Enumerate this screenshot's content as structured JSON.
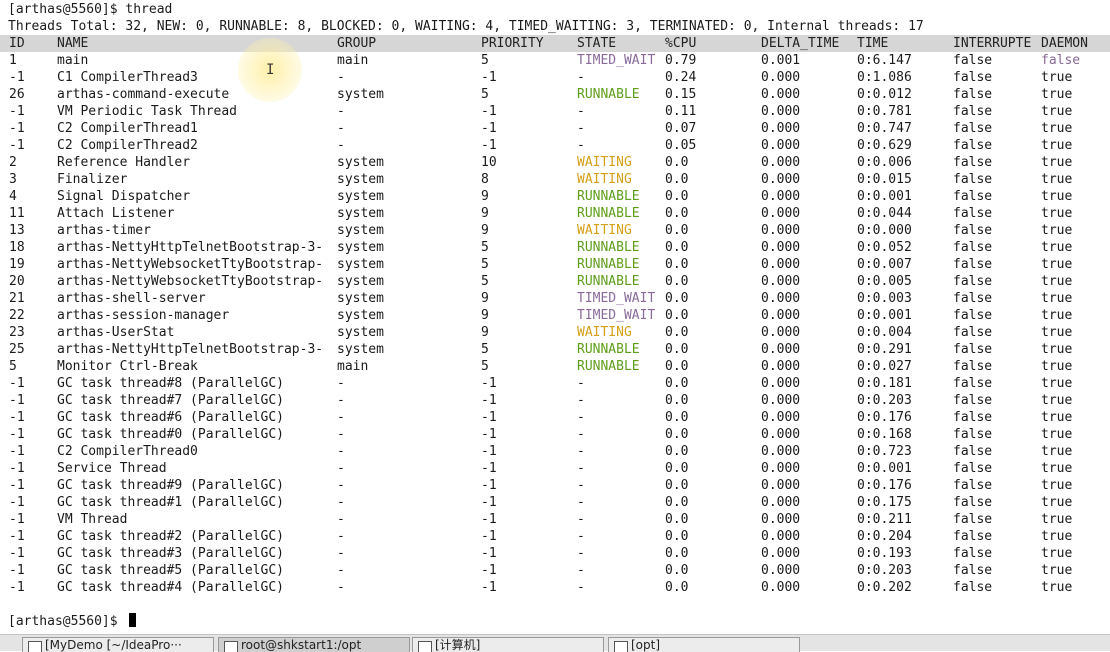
{
  "prompt": "[arthas@5560]$ ",
  "command": "thread",
  "summary": "Threads Total: 32, NEW: 0, RUNNABLE: 8, BLOCKED: 0, WAITING: 4, TIMED_WAITING: 3, TERMINATED: 0, Internal threads: 17",
  "columns": [
    "ID",
    "NAME",
    "GROUP",
    "PRIORITY",
    "STATE",
    "%CPU",
    "DELTA_TIME",
    "TIME",
    "INTERRUPTE",
    "DAEMON"
  ],
  "rows": [
    [
      "1",
      "main",
      "main",
      "5",
      "TIMED_WAIT",
      "0.79",
      "0.001",
      "0:6.147",
      "false",
      "false"
    ],
    [
      "-1",
      "C1 CompilerThread3",
      "-",
      "-1",
      "-",
      "0.24",
      "0.000",
      "0:1.086",
      "false",
      "true"
    ],
    [
      "26",
      "arthas-command-execute",
      "system",
      "5",
      "RUNNABLE",
      "0.15",
      "0.000",
      "0:0.012",
      "false",
      "true"
    ],
    [
      "-1",
      "VM Periodic Task Thread",
      "-",
      "-1",
      "-",
      "0.11",
      "0.000",
      "0:0.781",
      "false",
      "true"
    ],
    [
      "-1",
      "C2 CompilerThread1",
      "-",
      "-1",
      "-",
      "0.07",
      "0.000",
      "0:0.747",
      "false",
      "true"
    ],
    [
      "-1",
      "C2 CompilerThread2",
      "-",
      "-1",
      "-",
      "0.05",
      "0.000",
      "0:0.629",
      "false",
      "true"
    ],
    [
      "2",
      "Reference Handler",
      "system",
      "10",
      "WAITING",
      "0.0",
      "0.000",
      "0:0.006",
      "false",
      "true"
    ],
    [
      "3",
      "Finalizer",
      "system",
      "8",
      "WAITING",
      "0.0",
      "0.000",
      "0:0.015",
      "false",
      "true"
    ],
    [
      "4",
      "Signal Dispatcher",
      "system",
      "9",
      "RUNNABLE",
      "0.0",
      "0.000",
      "0:0.001",
      "false",
      "true"
    ],
    [
      "11",
      "Attach Listener",
      "system",
      "9",
      "RUNNABLE",
      "0.0",
      "0.000",
      "0:0.044",
      "false",
      "true"
    ],
    [
      "13",
      "arthas-timer",
      "system",
      "9",
      "WAITING",
      "0.0",
      "0.000",
      "0:0.000",
      "false",
      "true"
    ],
    [
      "18",
      "arthas-NettyHttpTelnetBootstrap-3-",
      "system",
      "5",
      "RUNNABLE",
      "0.0",
      "0.000",
      "0:0.052",
      "false",
      "true"
    ],
    [
      "19",
      "arthas-NettyWebsocketTtyBootstrap-",
      "system",
      "5",
      "RUNNABLE",
      "0.0",
      "0.000",
      "0:0.007",
      "false",
      "true"
    ],
    [
      "20",
      "arthas-NettyWebsocketTtyBootstrap-",
      "system",
      "5",
      "RUNNABLE",
      "0.0",
      "0.000",
      "0:0.005",
      "false",
      "true"
    ],
    [
      "21",
      "arthas-shell-server",
      "system",
      "9",
      "TIMED_WAIT",
      "0.0",
      "0.000",
      "0:0.003",
      "false",
      "true"
    ],
    [
      "22",
      "arthas-session-manager",
      "system",
      "9",
      "TIMED_WAIT",
      "0.0",
      "0.000",
      "0:0.001",
      "false",
      "true"
    ],
    [
      "23",
      "arthas-UserStat",
      "system",
      "9",
      "WAITING",
      "0.0",
      "0.000",
      "0:0.004",
      "false",
      "true"
    ],
    [
      "25",
      "arthas-NettyHttpTelnetBootstrap-3-",
      "system",
      "5",
      "RUNNABLE",
      "0.0",
      "0.000",
      "0:0.291",
      "false",
      "true"
    ],
    [
      "5",
      "Monitor Ctrl-Break",
      "main",
      "5",
      "RUNNABLE",
      "0.0",
      "0.000",
      "0:0.027",
      "false",
      "true"
    ],
    [
      "-1",
      "GC task thread#8 (ParallelGC)",
      "-",
      "-1",
      "-",
      "0.0",
      "0.000",
      "0:0.181",
      "false",
      "true"
    ],
    [
      "-1",
      "GC task thread#7 (ParallelGC)",
      "-",
      "-1",
      "-",
      "0.0",
      "0.000",
      "0:0.203",
      "false",
      "true"
    ],
    [
      "-1",
      "GC task thread#6 (ParallelGC)",
      "-",
      "-1",
      "-",
      "0.0",
      "0.000",
      "0:0.176",
      "false",
      "true"
    ],
    [
      "-1",
      "GC task thread#0 (ParallelGC)",
      "-",
      "-1",
      "-",
      "0.0",
      "0.000",
      "0:0.168",
      "false",
      "true"
    ],
    [
      "-1",
      "C2 CompilerThread0",
      "-",
      "-1",
      "-",
      "0.0",
      "0.000",
      "0:0.723",
      "false",
      "true"
    ],
    [
      "-1",
      "Service Thread",
      "-",
      "-1",
      "-",
      "0.0",
      "0.000",
      "0:0.001",
      "false",
      "true"
    ],
    [
      "-1",
      "GC task thread#9 (ParallelGC)",
      "-",
      "-1",
      "-",
      "0.0",
      "0.000",
      "0:0.176",
      "false",
      "true"
    ],
    [
      "-1",
      "GC task thread#1 (ParallelGC)",
      "-",
      "-1",
      "-",
      "0.0",
      "0.000",
      "0:0.175",
      "false",
      "true"
    ],
    [
      "-1",
      "VM Thread",
      "-",
      "-1",
      "-",
      "0.0",
      "0.000",
      "0:0.211",
      "false",
      "true"
    ],
    [
      "-1",
      "GC task thread#2 (ParallelGC)",
      "-",
      "-1",
      "-",
      "0.0",
      "0.000",
      "0:0.204",
      "false",
      "true"
    ],
    [
      "-1",
      "GC task thread#3 (ParallelGC)",
      "-",
      "-1",
      "-",
      "0.0",
      "0.000",
      "0:0.193",
      "false",
      "true"
    ],
    [
      "-1",
      "GC task thread#5 (ParallelGC)",
      "-",
      "-1",
      "-",
      "0.0",
      "0.000",
      "0:0.203",
      "false",
      "true"
    ],
    [
      "-1",
      "GC task thread#4 (ParallelGC)",
      "-",
      "-1",
      "-",
      "0.0",
      "0.000",
      "0:0.202",
      "false",
      "true"
    ]
  ],
  "state_colors": {
    "RUNNABLE": "#5f9e1b",
    "WAITING": "#d4a017",
    "TIMED_WAIT": "#8a6a9a"
  },
  "taskbar": [
    {
      "label": "[MyDemo [~/IdeaPro···",
      "icon": "intellij-icon"
    },
    {
      "label": "root@shkstart1:/opt",
      "icon": "terminal-icon"
    },
    {
      "label": "[计算机]",
      "icon": "computer-icon"
    },
    {
      "label": "[opt]",
      "icon": "folder-icon"
    }
  ]
}
